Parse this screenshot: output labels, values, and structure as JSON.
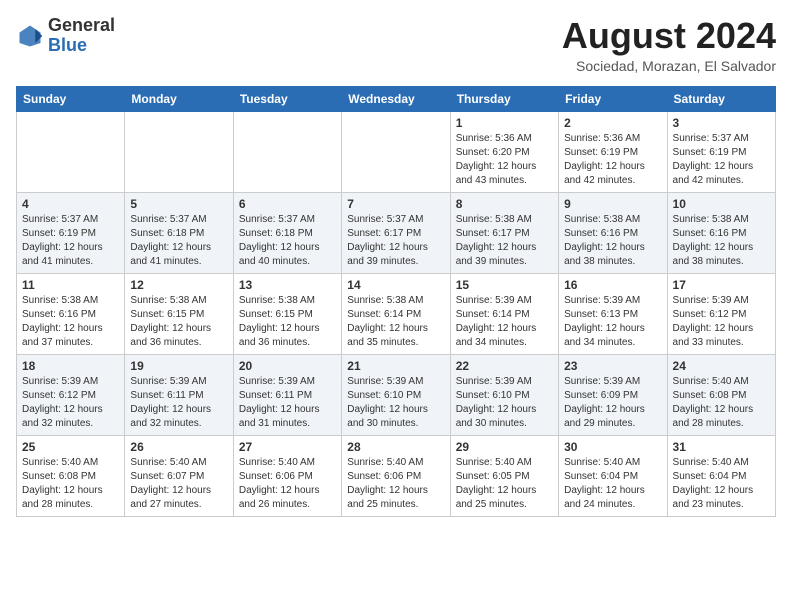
{
  "logo": {
    "general": "General",
    "blue": "Blue"
  },
  "header": {
    "month_year": "August 2024",
    "location": "Sociedad, Morazan, El Salvador"
  },
  "weekdays": [
    "Sunday",
    "Monday",
    "Tuesday",
    "Wednesday",
    "Thursday",
    "Friday",
    "Saturday"
  ],
  "weeks": [
    [
      {
        "day": "",
        "info": ""
      },
      {
        "day": "",
        "info": ""
      },
      {
        "day": "",
        "info": ""
      },
      {
        "day": "",
        "info": ""
      },
      {
        "day": "1",
        "info": "Sunrise: 5:36 AM\nSunset: 6:20 PM\nDaylight: 12 hours and 43 minutes."
      },
      {
        "day": "2",
        "info": "Sunrise: 5:36 AM\nSunset: 6:19 PM\nDaylight: 12 hours and 42 minutes."
      },
      {
        "day": "3",
        "info": "Sunrise: 5:37 AM\nSunset: 6:19 PM\nDaylight: 12 hours and 42 minutes."
      }
    ],
    [
      {
        "day": "4",
        "info": "Sunrise: 5:37 AM\nSunset: 6:19 PM\nDaylight: 12 hours and 41 minutes."
      },
      {
        "day": "5",
        "info": "Sunrise: 5:37 AM\nSunset: 6:18 PM\nDaylight: 12 hours and 41 minutes."
      },
      {
        "day": "6",
        "info": "Sunrise: 5:37 AM\nSunset: 6:18 PM\nDaylight: 12 hours and 40 minutes."
      },
      {
        "day": "7",
        "info": "Sunrise: 5:37 AM\nSunset: 6:17 PM\nDaylight: 12 hours and 39 minutes."
      },
      {
        "day": "8",
        "info": "Sunrise: 5:38 AM\nSunset: 6:17 PM\nDaylight: 12 hours and 39 minutes."
      },
      {
        "day": "9",
        "info": "Sunrise: 5:38 AM\nSunset: 6:16 PM\nDaylight: 12 hours and 38 minutes."
      },
      {
        "day": "10",
        "info": "Sunrise: 5:38 AM\nSunset: 6:16 PM\nDaylight: 12 hours and 38 minutes."
      }
    ],
    [
      {
        "day": "11",
        "info": "Sunrise: 5:38 AM\nSunset: 6:16 PM\nDaylight: 12 hours and 37 minutes."
      },
      {
        "day": "12",
        "info": "Sunrise: 5:38 AM\nSunset: 6:15 PM\nDaylight: 12 hours and 36 minutes."
      },
      {
        "day": "13",
        "info": "Sunrise: 5:38 AM\nSunset: 6:15 PM\nDaylight: 12 hours and 36 minutes."
      },
      {
        "day": "14",
        "info": "Sunrise: 5:38 AM\nSunset: 6:14 PM\nDaylight: 12 hours and 35 minutes."
      },
      {
        "day": "15",
        "info": "Sunrise: 5:39 AM\nSunset: 6:14 PM\nDaylight: 12 hours and 34 minutes."
      },
      {
        "day": "16",
        "info": "Sunrise: 5:39 AM\nSunset: 6:13 PM\nDaylight: 12 hours and 34 minutes."
      },
      {
        "day": "17",
        "info": "Sunrise: 5:39 AM\nSunset: 6:12 PM\nDaylight: 12 hours and 33 minutes."
      }
    ],
    [
      {
        "day": "18",
        "info": "Sunrise: 5:39 AM\nSunset: 6:12 PM\nDaylight: 12 hours and 32 minutes."
      },
      {
        "day": "19",
        "info": "Sunrise: 5:39 AM\nSunset: 6:11 PM\nDaylight: 12 hours and 32 minutes."
      },
      {
        "day": "20",
        "info": "Sunrise: 5:39 AM\nSunset: 6:11 PM\nDaylight: 12 hours and 31 minutes."
      },
      {
        "day": "21",
        "info": "Sunrise: 5:39 AM\nSunset: 6:10 PM\nDaylight: 12 hours and 30 minutes."
      },
      {
        "day": "22",
        "info": "Sunrise: 5:39 AM\nSunset: 6:10 PM\nDaylight: 12 hours and 30 minutes."
      },
      {
        "day": "23",
        "info": "Sunrise: 5:39 AM\nSunset: 6:09 PM\nDaylight: 12 hours and 29 minutes."
      },
      {
        "day": "24",
        "info": "Sunrise: 5:40 AM\nSunset: 6:08 PM\nDaylight: 12 hours and 28 minutes."
      }
    ],
    [
      {
        "day": "25",
        "info": "Sunrise: 5:40 AM\nSunset: 6:08 PM\nDaylight: 12 hours and 28 minutes."
      },
      {
        "day": "26",
        "info": "Sunrise: 5:40 AM\nSunset: 6:07 PM\nDaylight: 12 hours and 27 minutes."
      },
      {
        "day": "27",
        "info": "Sunrise: 5:40 AM\nSunset: 6:06 PM\nDaylight: 12 hours and 26 minutes."
      },
      {
        "day": "28",
        "info": "Sunrise: 5:40 AM\nSunset: 6:06 PM\nDaylight: 12 hours and 25 minutes."
      },
      {
        "day": "29",
        "info": "Sunrise: 5:40 AM\nSunset: 6:05 PM\nDaylight: 12 hours and 25 minutes."
      },
      {
        "day": "30",
        "info": "Sunrise: 5:40 AM\nSunset: 6:04 PM\nDaylight: 12 hours and 24 minutes."
      },
      {
        "day": "31",
        "info": "Sunrise: 5:40 AM\nSunset: 6:04 PM\nDaylight: 12 hours and 23 minutes."
      }
    ]
  ]
}
